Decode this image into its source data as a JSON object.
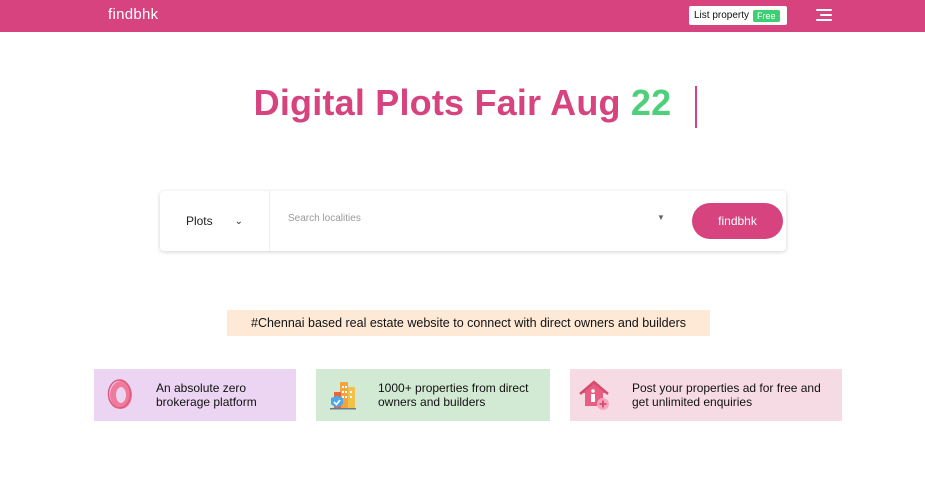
{
  "header": {
    "brand": "findbhk",
    "list_property_label": "List property",
    "free_badge": "Free"
  },
  "hero": {
    "title": "Digital Plots Fair Aug",
    "accent": "22"
  },
  "search": {
    "type_selected": "Plots",
    "locality_placeholder": "Search localities",
    "submit_label": "findbhk"
  },
  "tagline": "#Chennai based real estate website to connect with direct owners and builders",
  "features": [
    {
      "line1": "An absolute zero",
      "line2": "brokerage platform",
      "icon": "zero-icon"
    },
    {
      "line1": "1000+ properties from direct",
      "line2": "owners and builders",
      "icon": "buildings-icon"
    },
    {
      "line1": "Post your properties ad for free and",
      "line2": "get unlimited enquiries",
      "icon": "house-add-icon"
    }
  ],
  "colors": {
    "brand": "#d6437f",
    "accent": "#4fcf7a",
    "tagline_bg": "#fde9d6"
  }
}
